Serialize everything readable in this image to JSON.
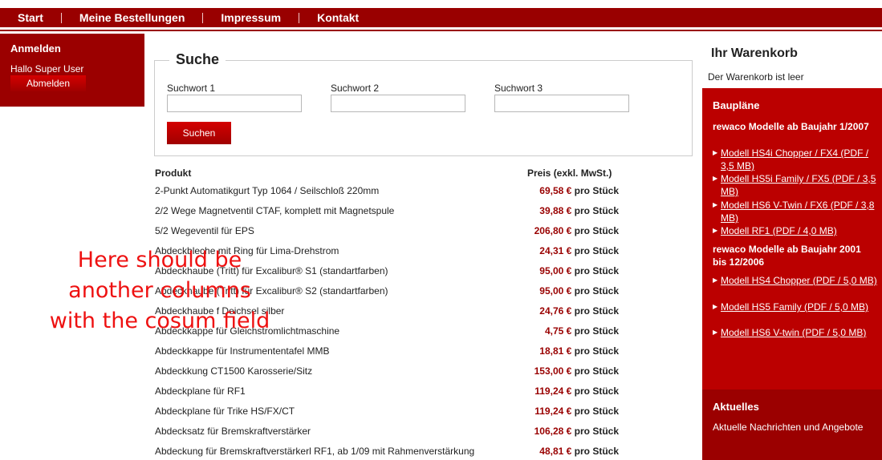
{
  "nav": {
    "items": [
      "Start",
      "Meine Bestellungen",
      "Impressum",
      "Kontakt"
    ]
  },
  "login": {
    "title": "Anmelden",
    "greeting": "Hallo Super User",
    "logout_label": "Abmelden"
  },
  "search": {
    "legend": "Suche",
    "fields": [
      {
        "label": "Suchwort 1",
        "value": ""
      },
      {
        "label": "Suchwort 2",
        "value": ""
      },
      {
        "label": "Suchwort 3",
        "value": ""
      }
    ],
    "button_label": "Suchen"
  },
  "products": {
    "col_product": "Produkt",
    "col_price": "Preis (exkl. MwSt.)",
    "unit": "pro Stück",
    "rows": [
      {
        "name": "2-Punkt Automatikgurt Typ 1064 / Seilschloß 220mm",
        "price": "69,58 €"
      },
      {
        "name": "2/2 Wege Magnetventil CTAF, komplett mit Magnetspule",
        "price": "39,88 €"
      },
      {
        "name": "5/2 Wegeventil für EPS",
        "price": "206,80 €"
      },
      {
        "name": "Abdeckbleche mit Ring für Lima-Drehstrom",
        "price": "24,31 €"
      },
      {
        "name": "Abdeckhaube (Tritt) für Excalibur® S1 (standartfarben)",
        "price": "95,00 €"
      },
      {
        "name": "Abdeckhaube (Tritt) für Excalibur® S2 (standartfarben)",
        "price": "95,00 €"
      },
      {
        "name": "Abdeckhaube f Deichsel silber",
        "price": "24,76 €"
      },
      {
        "name": "Abdeckkappe für Gleichstromlichtmaschine",
        "price": "4,75 €"
      },
      {
        "name": "Abdeckkappe für Instrumententafel MMB",
        "price": "18,81 €"
      },
      {
        "name": "Abdeckkung CT1500 Karosserie/Sitz",
        "price": "153,00 €"
      },
      {
        "name": "Abdeckplane für RF1",
        "price": "119,24 €"
      },
      {
        "name": "Abdeckplane für Trike HS/FX/CT",
        "price": "119,24 €"
      },
      {
        "name": "Abdecksatz für Bremskraftverstärker",
        "price": "106,28 €"
      },
      {
        "name": "Abdeckung für Bremskraftverstärkerl RF1, ab 1/09 mit Rahmenverstärkung",
        "price": "48,81 €"
      }
    ]
  },
  "annotation": {
    "text": "Here should be\nanother columns\nwith the cosum field"
  },
  "cart": {
    "title": "Ihr Warenkorb",
    "empty_text": "Der Warenkorb ist leer"
  },
  "plans": {
    "title": "Baupläne",
    "group1_title": "rewaco Modelle ab Baujahr 1/2007",
    "group1_links": [
      "Modell HS4i Chopper / FX4 (PDF / 3,5 MB)",
      "Modell HS5i Family / FX5 (PDF / 3,5 MB)",
      "Modell HS6 V-Twin / FX6 (PDF / 3,8 MB)",
      "Modell RF1 (PDF / 4,0 MB)"
    ],
    "group2_title": "rewaco Modelle ab Baujahr 2001 bis 12/2006",
    "group2_links": [
      "Modell HS4 Chopper (PDF / 5,0 MB)",
      "Modell HS5 Family (PDF / 5,0 MB)",
      "Modell HS6 V-twin (PDF / 5,0 MB)"
    ]
  },
  "news": {
    "title": "Aktuelles",
    "text": "Aktuelle Nachrichten und Angebote"
  },
  "colors": {
    "brand_red": "#990000",
    "panel_red": "#bb0000",
    "annotation_red": "#ee1111"
  }
}
